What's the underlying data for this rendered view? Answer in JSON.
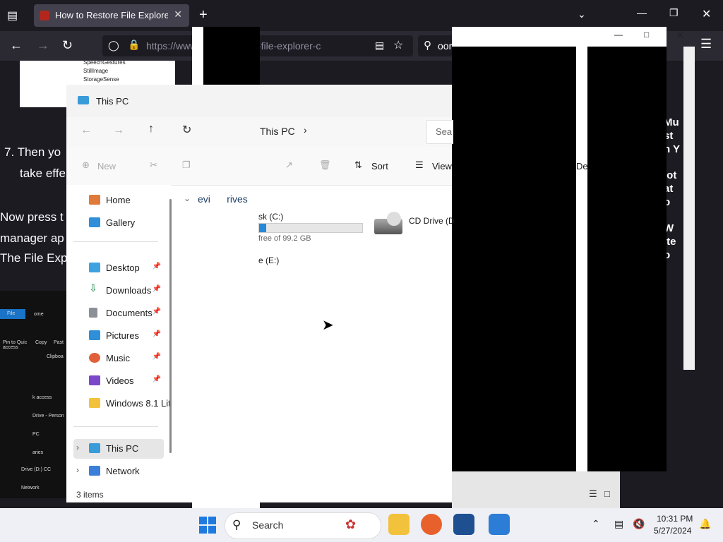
{
  "browser": {
    "tab_title": "How to Restore File Explorer's C",
    "url": "https://www.ma          m/restore-file-explorer-c",
    "search_text": "oor"
  },
  "article": {
    "step7_line1": "7.  Then yo",
    "step7_line2": "take effe",
    "para1": "Now press t",
    "para2": "manager ap",
    "para3": "The File Exp",
    "right_col": [
      "Mu",
      "st",
      "n Y",
      "lot",
      "at",
      "o",
      "W",
      "ite",
      "o"
    ],
    "heading_letter": "N",
    "tree_items": [
      "SpeechGestures",
      "StillImage",
      "StorageSense"
    ]
  },
  "explorer": {
    "window_title": "This PC",
    "breadcrumb": "This PC",
    "search_placeholder": "Sea",
    "cmd_new": "New",
    "cmd_sort": "Sort",
    "cmd_view": "View",
    "cmd_details": "De",
    "section_header": "evi      rives",
    "drive_c_label": "sk (C:)",
    "drive_c_free": "free of 99.2 GB",
    "drive_c_fill": 0.07,
    "drive_e_label": "e (E:)",
    "cd_drive_label": "CD Drive (D",
    "status": "3 items",
    "sidebar": [
      {
        "label": "Home",
        "icon": "home-icon",
        "pinned": false
      },
      {
        "label": "Gallery",
        "icon": "gallery-icon",
        "pinned": false
      },
      {
        "label": "Desktop",
        "icon": "desktop-icon",
        "pinned": true
      },
      {
        "label": "Downloads",
        "icon": "downloads-icon",
        "pinned": true
      },
      {
        "label": "Documents",
        "icon": "documents-icon",
        "pinned": true
      },
      {
        "label": "Pictures",
        "icon": "pictures-icon",
        "pinned": true
      },
      {
        "label": "Music",
        "icon": "music-icon",
        "pinned": true
      },
      {
        "label": "Videos",
        "icon": "videos-icon",
        "pinned": true
      },
      {
        "label": "Windows 8.1 Lit",
        "icon": "folder-icon",
        "pinned": false
      },
      {
        "label": "This PC",
        "icon": "this-pc-icon",
        "pinned": false
      },
      {
        "label": "Network",
        "icon": "network-icon",
        "pinned": false
      }
    ]
  },
  "embedded_screenshot": {
    "file_tab": "File",
    "home_tab": "ome",
    "pin_label": "Pin to Quic access",
    "copy_label": "Copy",
    "paste_label": "Past",
    "clipboard_label": "Clipboa",
    "nav_items": [
      "k access",
      "Drive - Person",
      "PC",
      "aries",
      "Drive (D:) CC",
      "Network"
    ]
  },
  "taskbar": {
    "search_placeholder": "Search",
    "time": "10:31 PM",
    "date": "5/27/2024"
  },
  "colors": {
    "accent": "#0067c0",
    "firefox_tab_bg": "#42414d",
    "chrome_bg": "#1c1b22"
  }
}
